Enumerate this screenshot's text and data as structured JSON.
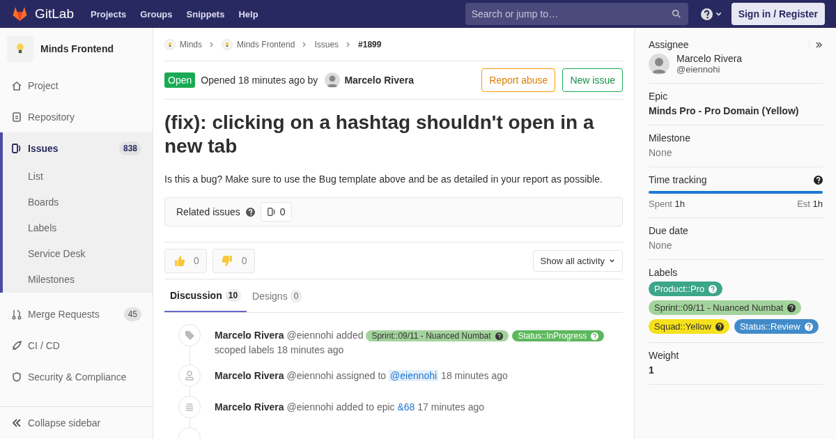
{
  "navbar": {
    "brand": "GitLab",
    "links": [
      "Projects",
      "Groups",
      "Snippets",
      "Help"
    ],
    "search": {
      "placeholder": "Search or jump to…"
    },
    "sign_in": "Sign in / Register"
  },
  "sidebar": {
    "project": "Minds Frontend",
    "items": [
      {
        "label": "Project",
        "kind": "home",
        "selected": false
      },
      {
        "label": "Repository",
        "kind": "repository",
        "selected": false
      },
      {
        "label": "Issues",
        "kind": "issues",
        "count": "838",
        "selected": true,
        "children": [
          {
            "label": "List"
          },
          {
            "label": "Boards"
          },
          {
            "label": "Labels"
          },
          {
            "label": "Service Desk"
          },
          {
            "label": "Milestones"
          }
        ]
      },
      {
        "label": "Merge Requests",
        "kind": "merge",
        "count": "45",
        "selected": false
      },
      {
        "label": "CI / CD",
        "kind": "cicd",
        "selected": false
      },
      {
        "label": "Security & Compliance",
        "kind": "security",
        "selected": false
      }
    ],
    "collapse": "Collapse sidebar"
  },
  "breadcrumbs": [
    {
      "label": "Minds",
      "kind": "group"
    },
    {
      "label": "Minds Frontend",
      "kind": "project"
    },
    {
      "label": "Issues",
      "kind": "page"
    },
    {
      "label": "#1899",
      "kind": "page"
    }
  ],
  "issue": {
    "status": "Open",
    "opened": "Opened 18 minutes ago by",
    "author": "Marcelo Rivera",
    "actions": [
      "Report abuse",
      "New issue"
    ],
    "title": "(fix): clicking on a hashtag shouldn't open in a new tab",
    "description": "Is this a bug? Make sure to use the Bug template above and be as detailed in your report as possible.",
    "related": {
      "label": "Related issues",
      "count": "0"
    },
    "reactions": [
      {
        "kind": "up",
        "count": "0"
      },
      {
        "kind": "down",
        "count": "0"
      }
    ],
    "activity_filter": "Show all activity",
    "tabs": [
      {
        "label": "Discussion",
        "count": "10",
        "selected": true
      },
      {
        "label": "Designs",
        "count": "0",
        "selected": false
      }
    ],
    "activity": [
      {
        "kind": "labels",
        "author": "Marcelo Rivera",
        "segments": [
          {
            "kind": "text",
            "text": "@eiennohi added"
          },
          {
            "kind": "label",
            "text": "Sprint::09/11 - Nuanced Numbat",
            "color": "#a3d39c"
          },
          {
            "kind": "label",
            "text": "Status::InProgress",
            "color": "#5cb85c"
          },
          {
            "kind": "text",
            "text": "scoped labels 18 minutes ago"
          }
        ]
      },
      {
        "kind": "assign",
        "author": "Marcelo Rivera",
        "segments": [
          {
            "kind": "text",
            "text": "@eiennohi assigned to"
          },
          {
            "kind": "mention",
            "text": "@eiennohi"
          },
          {
            "kind": "text",
            "text": "18 minutes ago"
          }
        ]
      },
      {
        "kind": "epic",
        "author": "Marcelo Rivera",
        "segments": [
          {
            "kind": "text",
            "text": "@eiennohi added to epic"
          },
          {
            "kind": "link",
            "text": "&68"
          },
          {
            "kind": "text",
            "text": "17 minutes ago"
          }
        ]
      }
    ]
  },
  "right_sidebar": {
    "assignee": {
      "heading": "Assignee",
      "name": "Marcelo Rivera",
      "handle": "@eiennohi"
    },
    "epic": {
      "heading": "Epic",
      "value": "Minds Pro - Pro Domain (Yellow)"
    },
    "milestone": {
      "heading": "Milestone",
      "value": "None"
    },
    "time_tracking": {
      "heading": "Time tracking",
      "level": 1,
      "spent_label": "Spent",
      "spent": "1h",
      "est_label": "Est",
      "est": "1h"
    },
    "due_date": {
      "heading": "Due date",
      "value": "None"
    },
    "labels": {
      "heading": "Labels",
      "items": [
        {
          "text": "Product::Pro",
          "color": "#3ca68a"
        },
        {
          "text": "Sprint::09/11 - Nuanced Numbat",
          "color": "#a3d39c"
        },
        {
          "text": "Squad::Yellow",
          "color": "#f5e11c"
        },
        {
          "text": "Status::Review",
          "color": "#428bca"
        }
      ]
    },
    "weight": {
      "heading": "Weight",
      "value": "1"
    }
  }
}
